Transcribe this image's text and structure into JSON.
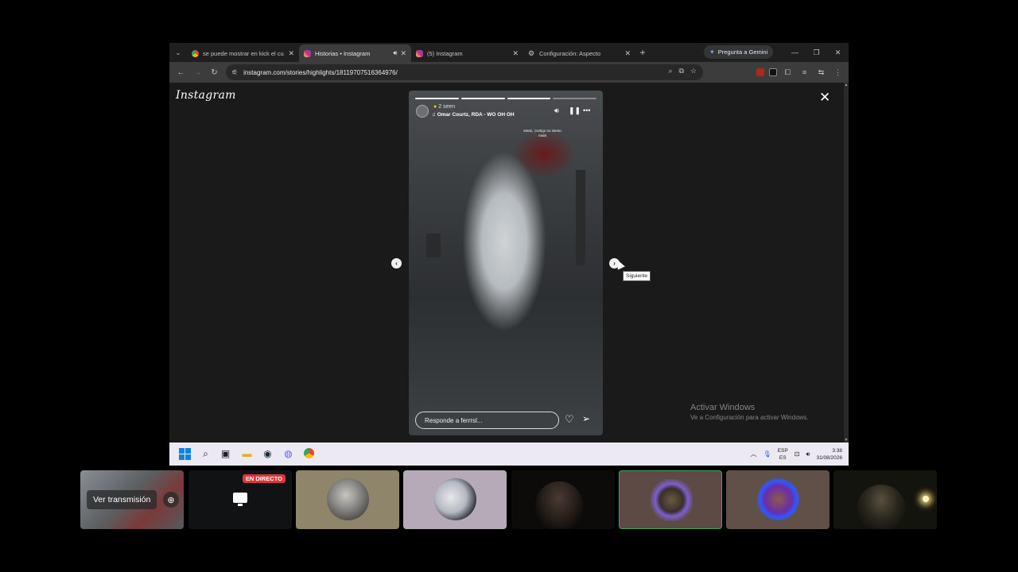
{
  "browser": {
    "tabs": [
      {
        "title": "se puede mostrar en kick el cu…",
        "favicon": "chrome-icon",
        "active": false
      },
      {
        "title": "Historias • Instagram",
        "favicon": "instagram-icon",
        "active": true,
        "audio": true
      },
      {
        "title": "(5) Instagram",
        "favicon": "instagram-icon",
        "active": false
      },
      {
        "title": "Configuración: Aspecto",
        "favicon": "gear-icon",
        "active": false
      }
    ],
    "gemini_label": "Pregunta a Gemini",
    "url": "instagram.com/stories/highlights/18119707516364976/"
  },
  "instagram": {
    "logo": "Instagram",
    "story": {
      "seen": "2 seen",
      "song": "Omar Courtz, RDA - WO OH OH",
      "overlay_text": [
        "Mami, contigo no siento",
        "nada"
      ],
      "reply_placeholder": "Responde a ferrrsl...",
      "progress_segments": 4,
      "progress_done": 3
    },
    "tooltip": "Siguiente"
  },
  "windows": {
    "activate_title": "Activar Windows",
    "activate_sub": "Ve a Configuración para activar Windows.",
    "lang_top": "ESP",
    "lang_bottom": "ES",
    "time": "3:38",
    "date": "31/08/2026"
  },
  "discord": {
    "watch_label": "Ver transmisión",
    "live_badge": "EN DIRECTO",
    "accent_green": "#3ba55c",
    "live_red": "#da373c"
  }
}
